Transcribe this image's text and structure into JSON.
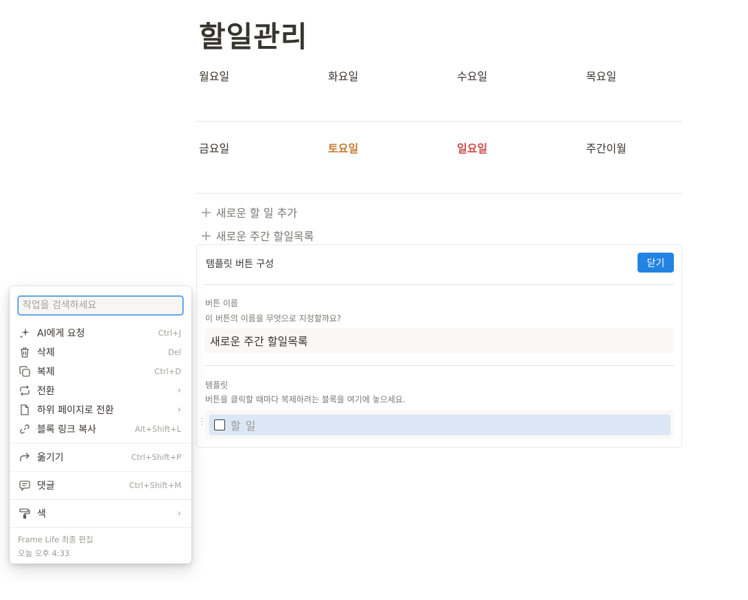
{
  "page": {
    "title": "할일관리"
  },
  "week": {
    "row1": [
      "월요일",
      "화요일",
      "수요일",
      "목요일"
    ],
    "row2": [
      "금요일",
      "토요일",
      "일요일",
      "주간이월"
    ]
  },
  "actions": {
    "add_todo": "새로운 할 일 추가",
    "add_weekly": "새로운 주간 할일목록"
  },
  "template_panel": {
    "title": "템플릿 버튼 구성",
    "close_label": "닫기",
    "name_label": "버튼 이름",
    "name_desc": "이 버튼의 이름을 무엇으로 지정할까요?",
    "name_value": "새로운 주간 할일목록",
    "template_label": "템플릿",
    "template_desc": "버튼을 클릭할 때마다 복제하려는 블록을 여기에 놓으세요.",
    "todo_text": "할 일"
  },
  "context_menu": {
    "search_placeholder": "작업을 검색하세요",
    "items": [
      {
        "icon": "sparkle-icon",
        "label": "AI에게 요청",
        "shortcut": "Ctrl+J"
      },
      {
        "icon": "trash-icon",
        "label": "삭제",
        "shortcut": "Del"
      },
      {
        "icon": "duplicate-icon",
        "label": "복제",
        "shortcut": "Ctrl+D"
      },
      {
        "icon": "turn-into-icon",
        "label": "전환",
        "shortcut": ""
      },
      {
        "icon": "page-icon",
        "label": "하위 페이지로 전환",
        "shortcut": ""
      },
      {
        "icon": "link-icon",
        "label": "블록 링크 복사",
        "shortcut": "Alt+Shift+L"
      },
      {
        "icon": "move-icon",
        "label": "옮기기",
        "shortcut": "Ctrl+Shift+P"
      },
      {
        "icon": "comment-icon",
        "label": "댓글",
        "shortcut": "Ctrl+Shift+M"
      },
      {
        "icon": "paint-roller-icon",
        "label": "색",
        "shortcut": ""
      }
    ],
    "footer_editor": "Frame Life 최종 편집",
    "footer_time": "오늘 오후 4:33"
  },
  "colors": {
    "accent": "#2383e2",
    "saturday": "#c47a2c",
    "sunday": "#c94a4a",
    "todo_highlight": "#dbe7f5"
  }
}
